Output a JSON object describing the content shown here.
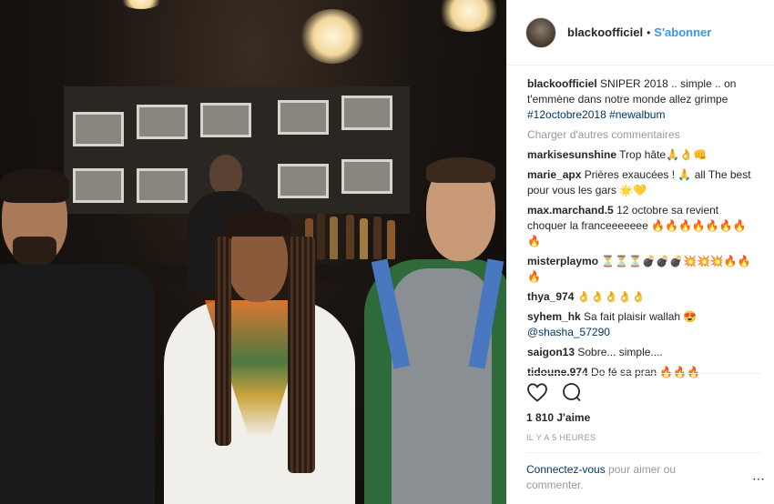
{
  "post": {
    "username": "blackoofficiel",
    "follow_label": "S'abonner",
    "caption_text": "SNIPER 2018 .. simple .. on t'emmène dans notre monde allez grimpe",
    "hashtags": "#12octobre2018 #newalbum"
  },
  "load_more_label": "Charger d'autres commentaires",
  "comments": [
    {
      "user": "markisesunshine",
      "text": "Trop hâte🙏👌👊"
    },
    {
      "user": "marie_apx",
      "text": "Prières exaucées ! 🙏 all The best pour vous les gars 🌟💛"
    },
    {
      "user": "max.marchand.5",
      "text": "12 octobre sa revient choquer la franceeeeeee 🔥🔥🔥🔥🔥🔥🔥🔥"
    },
    {
      "user": "misterplaymo",
      "text": "⏳⏳⏳💣💣💣💥💥💥🔥🔥🔥"
    },
    {
      "user": "thya_974",
      "text": "👌👌👌👌👌"
    },
    {
      "user": "syhem_hk",
      "text": "Sa fait plaisir wallah 😍",
      "mention": "@shasha_57290"
    },
    {
      "user": "saigon13",
      "text": "Sobre... simple...."
    },
    {
      "user": "tidoune.974",
      "text": "Do fé sa pran 🔥🔥🔥"
    }
  ],
  "likes": "1 810 J'aime",
  "timestamp": "IL Y A 5 HEURES",
  "login": {
    "link": "Connectez-vous",
    "text": " pour aimer ou commenter."
  },
  "icons": {
    "like": "heart-icon",
    "comment": "comment-bubble-icon",
    "more": "more-options-icon"
  },
  "colors": {
    "link": "#3897f0",
    "hashtag": "#003569",
    "muted": "#999999"
  }
}
